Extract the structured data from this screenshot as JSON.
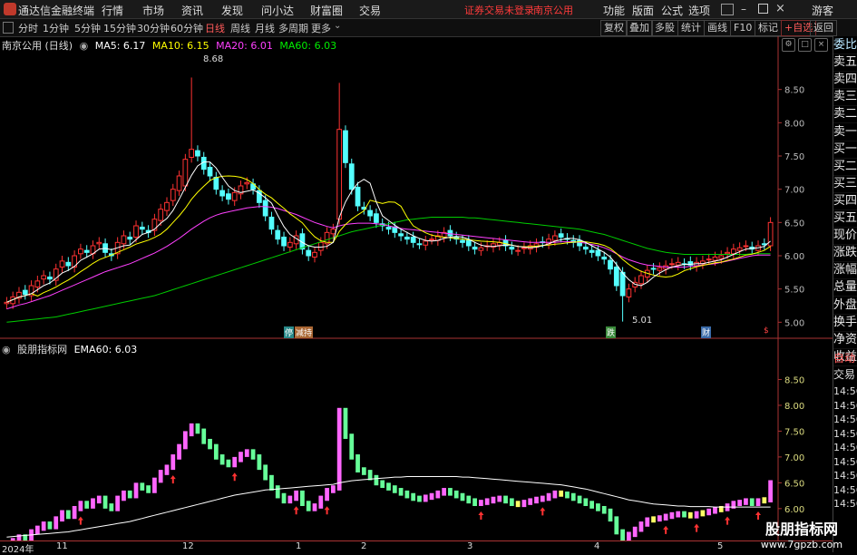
{
  "titlebar": {
    "app_name": "通达信金融终端",
    "menus": [
      "行情",
      "市场",
      "资讯",
      "发现",
      "问小达",
      "财富圈",
      "交易"
    ],
    "warning": "证券交易未登录",
    "stock_name": "南京公用",
    "right_menus": [
      "功能",
      "版面",
      "公式",
      "选项"
    ],
    "guest": "游客"
  },
  "toolbar": {
    "periods": [
      "分时",
      "1分钟",
      "5分钟",
      "15分钟",
      "30分钟",
      "60分钟",
      "日线",
      "周线",
      "月线",
      "多周期",
      "更多"
    ],
    "active_period": "日线",
    "right_buttons": [
      "复权",
      "叠加",
      "多股",
      "统计",
      "画线",
      "F10",
      "标记",
      "+自选",
      "返回"
    ]
  },
  "main_panel": {
    "title": "南京公用 (日线)",
    "ma5": "MA5: 6.17",
    "ma10": "MA10: 6.15",
    "ma20": "MA20: 6.01",
    "ma60": "MA60: 6.03",
    "high_label": "8.68",
    "low_label": "5.01",
    "event_tags": [
      "停",
      "减持",
      "跌",
      "财",
      "$"
    ]
  },
  "sub_panel": {
    "title": "股朋指标网",
    "ema60": "EMA60: 6.03"
  },
  "right_sidebar": {
    "items": [
      "委比",
      "卖五",
      "卖四",
      "卖三",
      "卖二",
      "卖一",
      "买一",
      "买二",
      "买三",
      "买四",
      "买五",
      "现价",
      "涨跌",
      "涨幅",
      "总量",
      "外盘",
      "换手",
      "净资",
      "收益"
    ],
    "auto_label": "自动",
    "trade_label": "交易",
    "times": [
      "14:56",
      "14:56",
      "14:56",
      "14:56",
      "14:56",
      "14:56",
      "14:56",
      "14:56",
      "14:56"
    ]
  },
  "axis": {
    "year": "2024年",
    "months": [
      "11",
      "12",
      "1",
      "2",
      "3",
      "4",
      "5"
    ]
  },
  "colors": {
    "up": "#ff3232",
    "down": "#54ffff",
    "ma5": "#ffffff",
    "ma10": "#ffff00",
    "ma20": "#ff40ff",
    "ma60": "#00cc00",
    "sub_up": "#ff66ff",
    "sub_down": "#66ff99",
    "sub_neutral": "#ffff66",
    "ema": "#ffffff"
  },
  "watermark": {
    "line1": "股朋指标网",
    "line2": "www.7gpzb.com"
  },
  "chart_data": {
    "type": "candlestick",
    "ylim_main": [
      4.8,
      9.0
    ],
    "ylim_sub": [
      5.4,
      9.0
    ],
    "yticks_main": [
      "5.00",
      "5.50",
      "6.00",
      "6.50",
      "7.00",
      "7.50",
      "8.00",
      "8.50"
    ],
    "yticks_sub": [
      "6.00",
      "6.50",
      "7.00",
      "7.50",
      "8.00",
      "8.50"
    ],
    "close": [
      5.3,
      5.38,
      5.45,
      5.42,
      5.55,
      5.62,
      5.7,
      5.65,
      5.8,
      5.92,
      5.85,
      6.0,
      6.1,
      6.05,
      6.15,
      6.2,
      6.05,
      6.0,
      6.2,
      6.3,
      6.25,
      6.45,
      6.4,
      6.35,
      6.55,
      6.7,
      6.8,
      7.0,
      7.2,
      7.45,
      7.6,
      7.5,
      7.3,
      7.2,
      7.0,
      6.9,
      6.85,
      6.95,
      7.05,
      7.1,
      7.0,
      6.8,
      6.6,
      6.4,
      6.25,
      6.15,
      6.2,
      6.3,
      6.1,
      6.0,
      6.05,
      6.2,
      6.35,
      6.4,
      7.9,
      7.4,
      7.0,
      6.75,
      6.7,
      6.6,
      6.5,
      6.45,
      6.4,
      6.35,
      6.3,
      6.25,
      6.2,
      6.18,
      6.22,
      6.25,
      6.3,
      6.35,
      6.3,
      6.25,
      6.2,
      6.15,
      6.1,
      6.12,
      6.15,
      6.18,
      6.2,
      6.15,
      6.1,
      6.08,
      6.12,
      6.15,
      6.18,
      6.2,
      6.25,
      6.3,
      6.28,
      6.25,
      6.2,
      6.15,
      6.1,
      6.05,
      6.0,
      5.95,
      5.8,
      5.55,
      5.4,
      5.5,
      5.6,
      5.7,
      5.78,
      5.8,
      5.82,
      5.85,
      5.88,
      5.9,
      5.88,
      5.86,
      5.9,
      5.92,
      5.95,
      5.98,
      6.0,
      6.05,
      6.1,
      6.12,
      6.15,
      6.1,
      6.15,
      6.17,
      6.5
    ],
    "ma5": [
      5.3,
      5.34,
      5.38,
      5.4,
      5.43,
      5.49,
      5.55,
      5.59,
      5.66,
      5.74,
      5.78,
      5.84,
      5.93,
      5.98,
      6.03,
      6.1,
      6.11,
      6.09,
      6.12,
      6.15,
      6.16,
      6.24,
      6.32,
      6.35,
      6.4,
      6.49,
      6.56,
      6.68,
      6.85,
      7.03,
      7.21,
      7.35,
      7.41,
      7.41,
      7.32,
      7.18,
      7.05,
      6.98,
      6.95,
      6.97,
      6.99,
      6.94,
      6.87,
      6.79,
      6.61,
      6.44,
      6.32,
      6.26,
      6.2,
      6.15,
      6.13,
      6.13,
      6.14,
      6.2,
      6.58,
      6.81,
      6.97,
      7.09,
      7.15,
      7.09,
      6.81,
      6.6,
      6.53,
      6.46,
      6.4,
      6.35,
      6.3,
      6.26,
      6.23,
      6.22,
      6.23,
      6.26,
      6.28,
      6.29,
      6.28,
      6.25,
      6.2,
      6.16,
      6.14,
      6.14,
      6.15,
      6.16,
      6.16,
      6.14,
      6.13,
      6.12,
      6.13,
      6.15,
      6.18,
      6.22,
      6.24,
      6.26,
      6.26,
      6.24,
      6.2,
      6.15,
      6.1,
      6.05,
      5.98,
      5.87,
      5.74,
      5.64,
      5.57,
      5.55,
      5.6,
      5.68,
      5.74,
      5.79,
      5.83,
      5.85,
      5.87,
      5.87,
      5.88,
      5.88,
      5.9,
      5.92,
      5.94,
      5.98,
      6.02,
      6.06,
      6.1,
      6.11,
      6.12,
      6.14,
      6.22
    ],
    "ma20": [
      5.2,
      5.23,
      5.26,
      5.28,
      5.31,
      5.34,
      5.37,
      5.4,
      5.44,
      5.48,
      5.52,
      5.56,
      5.6,
      5.64,
      5.68,
      5.72,
      5.76,
      5.79,
      5.82,
      5.85,
      5.88,
      5.92,
      5.96,
      6.0,
      6.04,
      6.09,
      6.14,
      6.2,
      6.26,
      6.33,
      6.4,
      6.46,
      6.52,
      6.57,
      6.61,
      6.64,
      6.66,
      6.68,
      6.7,
      6.72,
      6.73,
      6.74,
      6.74,
      6.73,
      6.71,
      6.68,
      6.65,
      6.62,
      6.58,
      6.54,
      6.5,
      6.47,
      6.44,
      6.42,
      6.45,
      6.47,
      6.48,
      6.49,
      6.49,
      6.49,
      6.48,
      6.47,
      6.45,
      6.43,
      6.41,
      6.4,
      6.39,
      6.38,
      6.37,
      6.36,
      6.35,
      6.34,
      6.33,
      6.32,
      6.31,
      6.3,
      6.29,
      6.28,
      6.27,
      6.26,
      6.25,
      6.24,
      6.23,
      6.22,
      6.21,
      6.2,
      6.2,
      6.2,
      6.2,
      6.2,
      6.21,
      6.21,
      6.21,
      6.2,
      6.19,
      6.17,
      6.15,
      6.12,
      6.08,
      6.03,
      5.98,
      5.94,
      5.91,
      5.88,
      5.86,
      5.85,
      5.84,
      5.83,
      5.83,
      5.83,
      5.83,
      5.84,
      5.85,
      5.86,
      5.87,
      5.88,
      5.9,
      5.92,
      5.94,
      5.96,
      5.98,
      6.0,
      6.01,
      6.01,
      6.01
    ],
    "ma60": [
      5.0,
      5.01,
      5.02,
      5.03,
      5.04,
      5.05,
      5.06,
      5.07,
      5.08,
      5.1,
      5.12,
      5.14,
      5.16,
      5.18,
      5.2,
      5.22,
      5.24,
      5.26,
      5.28,
      5.3,
      5.32,
      5.34,
      5.36,
      5.38,
      5.4,
      5.43,
      5.46,
      5.49,
      5.52,
      5.55,
      5.58,
      5.61,
      5.64,
      5.67,
      5.7,
      5.73,
      5.76,
      5.79,
      5.82,
      5.85,
      5.88,
      5.91,
      5.94,
      5.97,
      6.0,
      6.03,
      6.06,
      6.09,
      6.12,
      6.15,
      6.18,
      6.21,
      6.24,
      6.27,
      6.3,
      6.33,
      6.36,
      6.38,
      6.4,
      6.42,
      6.44,
      6.46,
      6.48,
      6.5,
      6.52,
      6.54,
      6.55,
      6.56,
      6.57,
      6.58,
      6.58,
      6.58,
      6.58,
      6.58,
      6.58,
      6.57,
      6.57,
      6.56,
      6.55,
      6.54,
      6.53,
      6.52,
      6.51,
      6.5,
      6.49,
      6.48,
      6.47,
      6.46,
      6.45,
      6.44,
      6.43,
      6.42,
      6.41,
      6.4,
      6.38,
      6.36,
      6.34,
      6.32,
      6.29,
      6.26,
      6.23,
      6.2,
      6.17,
      6.14,
      6.11,
      6.09,
      6.07,
      6.05,
      6.04,
      6.03,
      6.02,
      6.02,
      6.02,
      6.02,
      6.02,
      6.02,
      6.02,
      6.02,
      6.02,
      6.02,
      6.02,
      6.03,
      6.03,
      6.03,
      6.03
    ],
    "ema60": [
      5.45,
      5.46,
      5.47,
      5.48,
      5.49,
      5.5,
      5.51,
      5.52,
      5.53,
      5.54,
      5.55,
      5.57,
      5.59,
      5.61,
      5.63,
      5.65,
      5.67,
      5.69,
      5.71,
      5.73,
      5.75,
      5.78,
      5.81,
      5.84,
      5.87,
      5.9,
      5.93,
      5.96,
      5.99,
      6.02,
      6.05,
      6.08,
      6.11,
      6.14,
      6.17,
      6.2,
      6.23,
      6.26,
      6.28,
      6.3,
      6.32,
      6.34,
      6.36,
      6.37,
      6.38,
      6.39,
      6.4,
      6.41,
      6.42,
      6.43,
      6.44,
      6.45,
      6.46,
      6.47,
      6.5,
      6.52,
      6.54,
      6.55,
      6.56,
      6.57,
      6.58,
      6.59,
      6.6,
      6.61,
      6.61,
      6.62,
      6.62,
      6.62,
      6.62,
      6.62,
      6.62,
      6.62,
      6.62,
      6.62,
      6.61,
      6.61,
      6.6,
      6.59,
      6.58,
      6.57,
      6.56,
      6.55,
      6.54,
      6.53,
      6.52,
      6.51,
      6.5,
      6.49,
      6.48,
      6.47,
      6.46,
      6.44,
      6.42,
      6.4,
      6.38,
      6.35,
      6.32,
      6.29,
      6.26,
      6.23,
      6.2,
      6.17,
      6.15,
      6.13,
      6.11,
      6.09,
      6.08,
      6.07,
      6.06,
      6.05,
      6.05,
      6.04,
      6.04,
      6.04,
      6.04,
      6.03,
      6.03,
      6.03,
      6.03,
      6.03,
      6.03,
      6.03,
      6.03,
      6.03,
      6.03
    ]
  }
}
